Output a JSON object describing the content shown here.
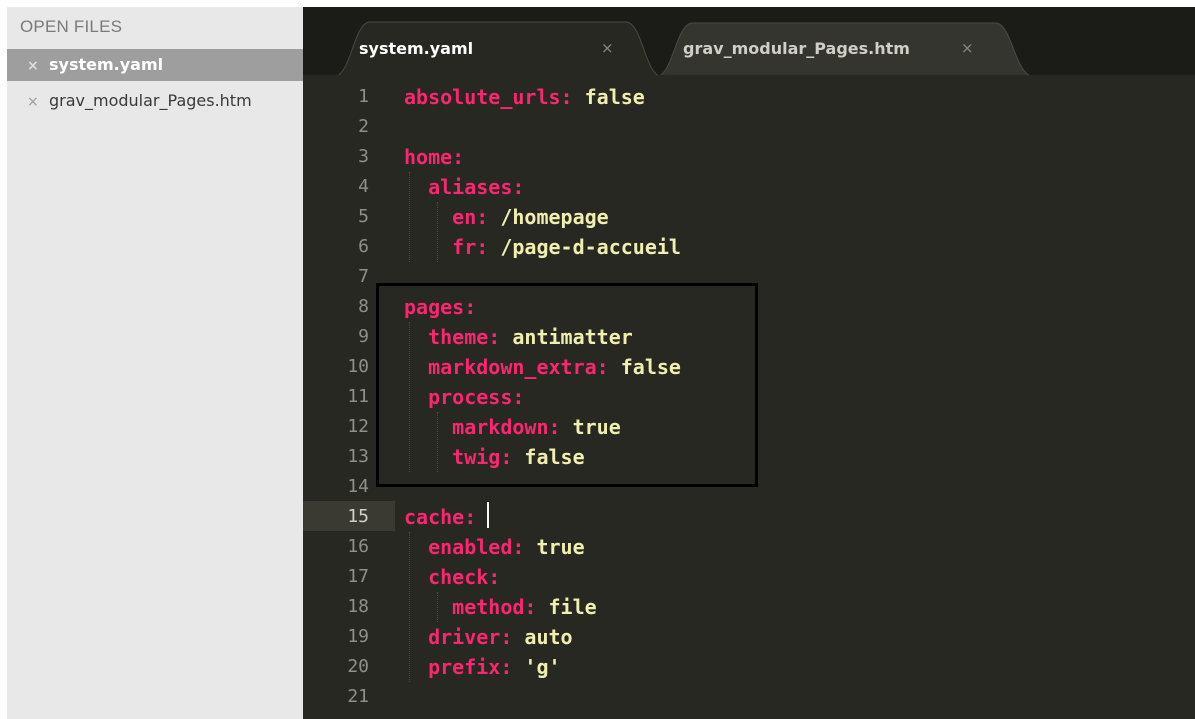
{
  "sidebar": {
    "header": "OPEN FILES",
    "close_glyph": "×",
    "files": [
      {
        "name": "system.yaml",
        "active": true
      },
      {
        "name": "grav_modular_Pages.htm",
        "active": false
      }
    ]
  },
  "tabs": [
    {
      "label": "system.yaml",
      "close": "×",
      "active": true
    },
    {
      "label": "grav_modular_Pages.htm",
      "close": "×",
      "active": false
    }
  ],
  "editor": {
    "current_line": 15,
    "lines": [
      {
        "n": "1",
        "key": "absolute_urls:",
        "val": " false"
      },
      {
        "n": "2",
        "key": "",
        "val": ""
      },
      {
        "n": "3",
        "key": "home:",
        "val": ""
      },
      {
        "n": "4",
        "key": "  aliases:",
        "val": ""
      },
      {
        "n": "5",
        "key": "    en:",
        "val": " /homepage"
      },
      {
        "n": "6",
        "key": "    fr:",
        "val": " /page-d-accueil"
      },
      {
        "n": "7",
        "key": "",
        "val": ""
      },
      {
        "n": "8",
        "key": "pages:",
        "val": ""
      },
      {
        "n": "9",
        "key": "  theme:",
        "val": " antimatter"
      },
      {
        "n": "10",
        "key": "  markdown_extra:",
        "val": " false"
      },
      {
        "n": "11",
        "key": "  process:",
        "val": ""
      },
      {
        "n": "12",
        "key": "    markdown:",
        "val": " true"
      },
      {
        "n": "13",
        "key": "    twig:",
        "val": " false"
      },
      {
        "n": "14",
        "key": "",
        "val": ""
      },
      {
        "n": "15",
        "key": "cache:",
        "val": ""
      },
      {
        "n": "16",
        "key": "  enabled:",
        "val": " true"
      },
      {
        "n": "17",
        "key": "  check:",
        "val": ""
      },
      {
        "n": "18",
        "key": "    method:",
        "val": " file"
      },
      {
        "n": "19",
        "key": "  driver:",
        "val": " auto"
      },
      {
        "n": "20",
        "key": "  prefix:",
        "val": " 'g'"
      },
      {
        "n": "21",
        "key": "",
        "val": ""
      }
    ]
  },
  "colors": {
    "editor_background": "#272822",
    "yaml_key": "#f92672",
    "yaml_value": "#f1efb0",
    "line_number": "#8f908a",
    "sidebar_background": "#e8e8e8",
    "sidebar_active": "#9e9e9e",
    "highlight_box": "#000000"
  }
}
